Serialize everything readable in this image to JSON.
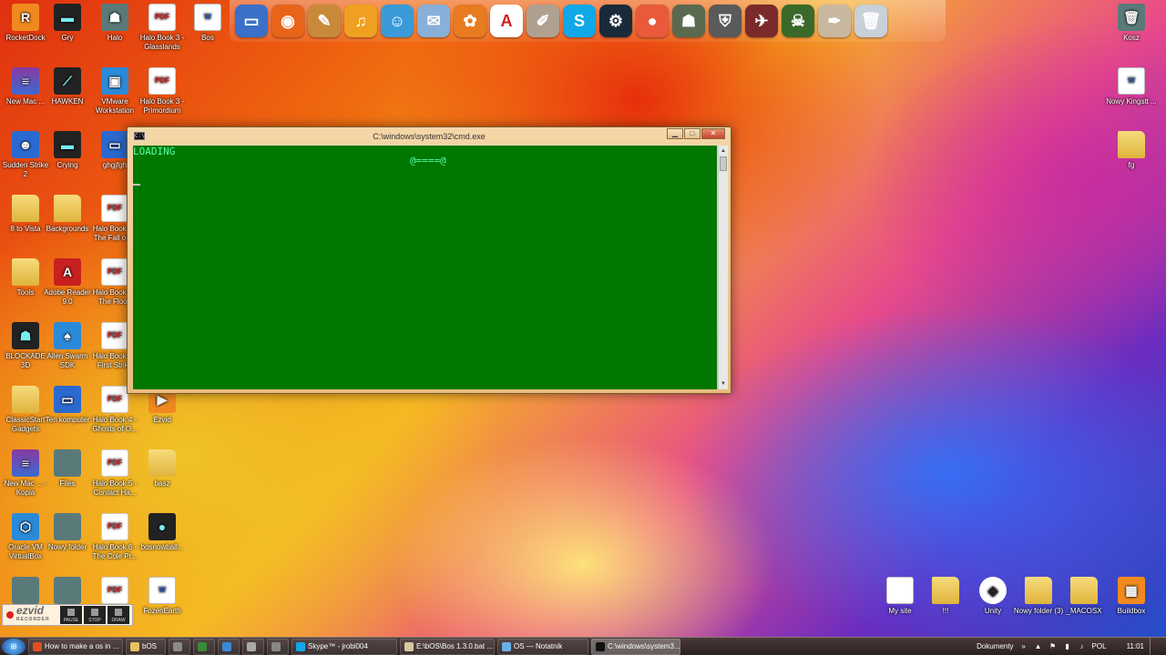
{
  "dock": {
    "items": [
      {
        "name": "computer",
        "glyph": "▭",
        "color": "#3a70c8"
      },
      {
        "name": "firefox",
        "glyph": "◉",
        "color": "#e8641a"
      },
      {
        "name": "media",
        "glyph": "✎",
        "color": "#c88a3a"
      },
      {
        "name": "audacity",
        "glyph": "♫",
        "color": "#f0a020"
      },
      {
        "name": "people",
        "glyph": "☺",
        "color": "#3a9ad8"
      },
      {
        "name": "mail",
        "glyph": "✉",
        "color": "#88b0d8"
      },
      {
        "name": "flower",
        "glyph": "✿",
        "color": "#e87a20"
      },
      {
        "name": "adobe",
        "glyph": "A",
        "color": "#ffffff"
      },
      {
        "name": "paint",
        "glyph": "✐",
        "color": "#b0a090"
      },
      {
        "name": "skype",
        "glyph": "S",
        "color": "#10a8e8"
      },
      {
        "name": "steam",
        "glyph": "⚙",
        "color": "#1a2a3a"
      },
      {
        "name": "record",
        "glyph": "●",
        "color": "#e85a3a"
      },
      {
        "name": "halo",
        "glyph": "☗",
        "color": "#5a6a50"
      },
      {
        "name": "shield",
        "glyph": "⛨",
        "color": "#5a5a5a"
      },
      {
        "name": "aircraft",
        "glyph": "✈",
        "color": "#7a2a2a"
      },
      {
        "name": "orc",
        "glyph": "☠",
        "color": "#3a6a2a"
      },
      {
        "name": "quill",
        "glyph": "✒",
        "color": "#c8b8a0"
      },
      {
        "name": "trash",
        "glyph": "🗑",
        "color": "#c8d0d8"
      }
    ]
  },
  "desktop_icons": [
    {
      "label": "RocketDock",
      "kind": "orange",
      "glyph": "R"
    },
    {
      "label": "Gry",
      "kind": "dark",
      "glyph": "▬"
    },
    {
      "label": "Halo",
      "kind": "gray",
      "glyph": "☗"
    },
    {
      "label": "Halo Book 3 - Glasslands",
      "kind": "pdf",
      "glyph": "PDF"
    },
    {
      "label": "Bos",
      "kind": "doc",
      "glyph": "W"
    },
    {
      "label": "New Mac ...",
      "kind": "rar",
      "glyph": "≡"
    },
    {
      "label": "HAWKEN",
      "kind": "dark",
      "glyph": "⟋"
    },
    {
      "label": "VMware Workstation",
      "kind": "blue",
      "glyph": "▣"
    },
    {
      "label": "Halo Book 3 - Primordium",
      "kind": "pdf",
      "glyph": "PDF"
    },
    {
      "label": "Sudden Strike 2",
      "kind": "monitor",
      "glyph": "☻"
    },
    {
      "label": "Crying",
      "kind": "dark",
      "glyph": "▬"
    },
    {
      "label": "ghgjfgh",
      "kind": "monitor",
      "glyph": "▭"
    },
    {
      "label": "8 to Vista",
      "kind": "folder",
      "glyph": ""
    },
    {
      "label": "Backgrounds",
      "kind": "folder",
      "glyph": ""
    },
    {
      "label": "Halo Book 4 - The Fall of ...",
      "kind": "pdf",
      "glyph": "PDF"
    },
    {
      "label": "Tools",
      "kind": "folder",
      "glyph": ""
    },
    {
      "label": "Adobe Reader 9.0",
      "kind": "red",
      "glyph": "A"
    },
    {
      "label": "Halo Book 5 - The Flood",
      "kind": "pdf",
      "glyph": "PDF"
    },
    {
      "label": "BLOCKADE 3D",
      "kind": "dark",
      "glyph": "☗"
    },
    {
      "label": "Allen Swarm SDK",
      "kind": "blue",
      "glyph": "♠"
    },
    {
      "label": "Halo Book 6 - First Strike",
      "kind": "pdf",
      "glyph": "PDF"
    },
    {
      "label": "ClassicStart Gadgets",
      "kind": "folder",
      "glyph": ""
    },
    {
      "label": "Ten komputer",
      "kind": "monitor",
      "glyph": "▭"
    },
    {
      "label": "Halo Book 4 - Ghosts of O...",
      "kind": "pdf",
      "glyph": "PDF"
    },
    {
      "label": "Ezvid",
      "kind": "orange",
      "glyph": "▶"
    },
    {
      "label": "New Mac ... - Kopia",
      "kind": "rar",
      "glyph": "≡"
    },
    {
      "label": "Files",
      "kind": "gray",
      "glyph": ""
    },
    {
      "label": "Halo Book 5 - Contact Ha...",
      "kind": "pdf",
      "glyph": "PDF"
    },
    {
      "label": "basz",
      "kind": "folder",
      "glyph": ""
    },
    {
      "label": "Oracle VM VirtualBox",
      "kind": "blue",
      "glyph": "⬡"
    },
    {
      "label": "Nowy folder",
      "kind": "gray",
      "glyph": ""
    },
    {
      "label": "Halo Book 6 - The Cole Pr...",
      "kind": "pdf",
      "glyph": "PDF"
    },
    {
      "label": "bosnowball...",
      "kind": "dark",
      "glyph": "●"
    },
    {
      "label": "",
      "kind": "gray",
      "glyph": ""
    },
    {
      "label": "",
      "kind": "gray",
      "glyph": ""
    },
    {
      "label": "",
      "kind": "pdf",
      "glyph": "PDF"
    },
    {
      "label": "FozenEarth",
      "kind": "doc",
      "glyph": "W"
    },
    {
      "label": "Kosz",
      "kind": "gray",
      "glyph": "🗑"
    },
    {
      "label": "Nowy Kingstt ...",
      "kind": "doc",
      "glyph": "W"
    },
    {
      "label": "fg",
      "kind": "folder",
      "glyph": ""
    },
    {
      "label": "My site",
      "kind": "doc",
      "glyph": ""
    },
    {
      "label": "!!!",
      "kind": "folder",
      "glyph": ""
    },
    {
      "label": "Unity",
      "kind": "unity",
      "glyph": "◆"
    },
    {
      "label": "Nowy folder (3)",
      "kind": "folder",
      "glyph": ""
    },
    {
      "label": "_MACOSX",
      "kind": "folder",
      "glyph": ""
    },
    {
      "label": "Buildbox",
      "kind": "orange",
      "glyph": "▦"
    }
  ],
  "cmd": {
    "title": "C:\\windows\\system32\\cmd.exe",
    "sysicon": "C:\\",
    "line1": "LOADING",
    "progress": "@====@",
    "minimize": "▁",
    "maximize": "□",
    "close": "✕",
    "scroll_up": "▲",
    "scroll_down": "▼"
  },
  "recorder": {
    "logo": "ezvid",
    "sub": "RECORDER",
    "pause": "PAUSE",
    "stop": "STOP",
    "draw": "DRAW"
  },
  "taskbar": {
    "start": "⊞",
    "items": [
      {
        "label": "How to make a os in ...",
        "color": "#e05020",
        "active": false
      },
      {
        "label": "bOS",
        "color": "#e8c060",
        "active": false
      },
      {
        "label": "",
        "color": "#8a8a8a",
        "active": false
      },
      {
        "label": "",
        "color": "#3a8a3a",
        "active": false
      },
      {
        "label": "",
        "color": "#3a8ad8",
        "active": false
      },
      {
        "label": "",
        "color": "#aaaaaa",
        "active": false
      },
      {
        "label": "",
        "color": "#888888",
        "active": false
      },
      {
        "label": "Skype™ - jrobi004",
        "color": "#10a8e8",
        "active": false
      },
      {
        "label": "E:\\bOS\\Bos 1.3.0.bat ...",
        "color": "#d8c8a0",
        "active": false
      },
      {
        "label": "OS — Notatnik",
        "color": "#6ab0e8",
        "active": false
      },
      {
        "label": "C:\\windows\\system3...",
        "color": "#111111",
        "active": true
      }
    ],
    "tray_label": "Dokumenty",
    "tray_lang": "POL",
    "clock": "11:01"
  }
}
